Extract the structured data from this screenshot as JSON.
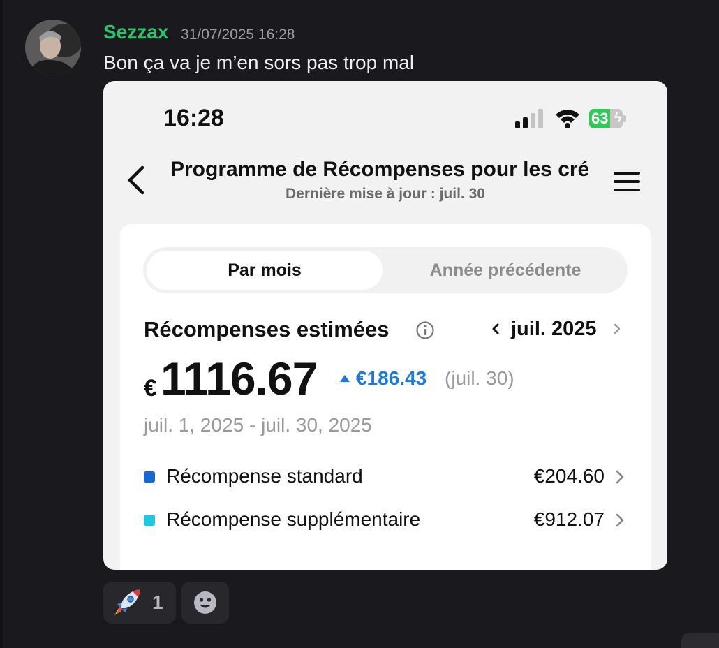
{
  "message": {
    "author": "Sezzax",
    "timestamp": "31/07/2025 16:28",
    "text": "Bon ça va je m’en sors pas trop mal",
    "author_color": "#2ec26a"
  },
  "phone": {
    "status_bar": {
      "time": "16:28",
      "battery_level": "63",
      "battery_fraction": 0.63,
      "signal_bars": 2,
      "icons": [
        "cellular-signal-icon",
        "wifi-icon",
        "battery-charging-icon"
      ]
    },
    "nav": {
      "title": "Programme de Récompenses pour les cré",
      "subtitle": "Dernière mise à jour : juil. 30",
      "back_icon": "chevron-left-icon",
      "menu_icon": "hamburger-menu-icon"
    },
    "tabs": [
      {
        "label": "Par mois",
        "active": true
      },
      {
        "label": "Année précédente",
        "active": false
      }
    ],
    "rewards": {
      "label": "Récompenses estimées",
      "month": "juil. 2025",
      "currency": "€",
      "amount": "1116.67",
      "delta": "€186.43",
      "delta_date": "(juil. 30)",
      "period": "juil. 1, 2025 - juil. 30, 2025",
      "accent_color": "#1f7ad6"
    },
    "breakdown": [
      {
        "label": "Récompense standard",
        "value": "€204.60",
        "color": "#1769d1"
      },
      {
        "label": "Récompense supplémentaire",
        "value": "€912.07",
        "color": "#1ec8e0"
      }
    ]
  },
  "reactions": [
    {
      "emoji": "rocket-emoji",
      "count": "1"
    }
  ],
  "add_reaction_icon": "add-reaction-smiley-icon"
}
